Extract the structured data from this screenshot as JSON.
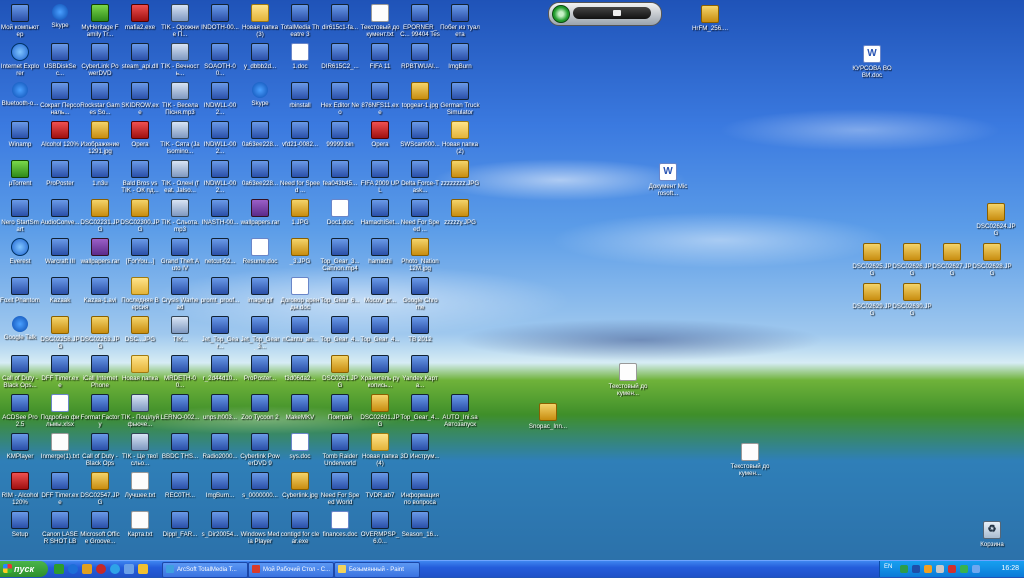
{
  "desktop": {
    "grid": [
      [
        "Мой компьютер",
        "Skype",
        "MyHeritage Family Tr...",
        "mafia2.exe",
        "TIK - Орожние П...",
        "INDOTH-00...",
        "Новая папка (3)",
        "TotalMedia Theatre 3",
        "dir615c1-fa...",
        "Текстовый документ.txt",
        "EPORNER_C... 99404 Test",
        "Побег из туалета"
      ],
      [
        "Internet Explorer",
        "USBDiskSec...",
        "CyberLink PowerDVD",
        "steam_api.dll",
        "TIK - Вечность...",
        "SOAOTH-00...",
        "y_dbbb2d...",
        "1.doc",
        "DIR615C2_...",
        "FIFA 11",
        "RPBTWUAI...",
        "ImgBurn"
      ],
      [
        "Bluetooth-о...",
        "Сократ Персональ...",
        "Rockstar Games So...",
        "SKIDROW.exe",
        "TIK - Весела Пісня.mp3",
        "INDWLL-002...",
        "Skype",
        "rbinstall",
        "Hex Editor Neo",
        "876NFS11.exe",
        "topgear-1.jpg",
        "German Truck Simulator"
      ],
      [
        "Winamp",
        "Alcohol 120%",
        "Изображение 1291.jpg",
        "Opera",
        "TIK - Сята (Jalsomino...",
        "INDWLL-002...",
        "0a63ee228...",
        "vfd21-0082...",
        "99999.bin",
        "Opera",
        "SWScan000...",
        "Новая папка (2)"
      ],
      [
        "µTorrent",
        "ProPoster",
        "1.n3u",
        "Bald Bros vs TIK - ОК пд...",
        "TIK - Олені (feat. Jalso...",
        "INDWLL-002...",
        "0a63ee228...",
        "Need for Speed ...",
        "fea043b45...",
        "FIFA 2009 UPL",
        "Delta Force-Task...",
        "zzzzzzzz.JPG"
      ],
      [
        "Nero StartSmart",
        "AudioConve...",
        "DSC02231.JPG",
        "DSC02300.JPG",
        "TIK - Сльота.mp3",
        "INASTH-00...",
        "wallpapers.rar",
        "1.JPG",
        "Doc1.doc",
        "HamachiSet...",
        "Need For Speed ...",
        "zzzzzy.JPG"
      ],
      [
        "Everest",
        "Warcraft III",
        "wallpapers.rar",
        "[ForYou...]",
        "Grand Theft Auto IV",
        "netcut-02...",
        "Resume.doc",
        "_3.JPG",
        "Top_Gear_3... Cannon.mp4",
        "hamachi",
        "Photo_Nation 12M.jpg",
        ""
      ],
      [
        "Foxit Phantom",
        "Kazaak",
        "Kazaa-1.avi",
        "Последняя Версия",
        "Crysis Warhead",
        "promt_proof...",
        "image.gif",
        "Договор аренды.doc",
        "Top_Gear_6...",
        "Mocov_pr...",
        "Google Chrome",
        ""
      ],
      [
        "Google Talk",
        "DSC02258.JPG",
        "DSC02263.JPG",
        "DSC...JPG",
        "TIK...",
        "Jet_Top_Gear...",
        "Jet_Top_Gear_3...",
        "nCantu_an...",
        "Top_Gear_4...",
        "Top_Gear_4...",
        "ТВ 2012",
        ""
      ],
      [
        "Call of Duty - Black Ops...",
        "DFF Timer.exe",
        "iCall Internet Phone",
        "Новая папка",
        "MRDETH-00...",
        "r_2d44d10...",
        "ProPoster...",
        "f3d06da2...",
        "DSC0261.JPG",
        "Хранитель рукопись...",
        "Yandex Карта...",
        ""
      ],
      [
        "ACDSee Pro 2.5",
        "Подробно фильмы.xlsx",
        "Format Factory",
        "TIK - Поцілуй фьюче...",
        "LERNO-002...",
        "unps.h003...",
        "Zoo Tycoon 2",
        "MakeMKV",
        "Поиграй",
        "DSC02601.JPG",
        "Top_Gear_4...",
        "AUTO_Ini.sa Автозапуск"
      ],
      [
        "KMPlayer",
        "Inmerge(1).txt",
        "Call of Duty - Black Ops",
        "TIK - Це твої сльо...",
        "BBDC THS...",
        "Radio2000...",
        "Cyberlink PowerDVD 9",
        "sys.doc",
        "Tomb Raider Underworld",
        "Новая папка (4)",
        "3D Инструм...",
        ""
      ],
      [
        "RIM - Alcohol 120%",
        "DFF Timer.exe",
        "DSC02547.JPG",
        "Лучшее.txt",
        "REC0TH...",
        "ImgBurn...",
        "s_0000000...",
        "Cyberlink.jpg",
        "Need For Speed World",
        "TVDR.ab7",
        "Информация по вопросам...",
        ""
      ],
      [
        "Setup",
        "Canon LASER SHOT LBP...",
        "Microsoft Office Groove...",
        "Карта.txt",
        "Dippl_FAR...",
        "s_Dir20054...",
        "Windows Media Player",
        "contigd for clear.exe",
        "finances.doc",
        "OVERMPSP_6.0...",
        "Season_16...",
        ""
      ]
    ],
    "right_icons": {
      "hrfm": "HrFM_256....",
      "kursova": "КУРСОВА ВОВИ.doc",
      "docword": "Документ Microsoft...",
      "dsc2624": "DSC02624.JPG",
      "dsc2625": "DSC02625.JPG",
      "dsc2626": "DSC02626.JPG",
      "dsc2627": "DSC02627.JPG",
      "dsc2628": "DSC02628.JPG",
      "dsc2629": "DSC02629.JPG",
      "dsc2630": "DSC02630.JPG",
      "textdoc1": "Текстовый докумен...",
      "snopac": "Snopac_Inn...",
      "textdoc2": "Текстовый докумен...",
      "recycle": "Корзина"
    }
  },
  "taskbar": {
    "start_label": "пуск",
    "tasks": [
      "ArcSoft TotalMedia T...",
      "Мой Рабочий Стол - С...",
      "Безымянный - Paint"
    ],
    "lang": "EN",
    "clock": "16:28"
  },
  "colors": {
    "taskbar": "#245ddb",
    "start": "#2d8f2d",
    "tray": "#0b7ad8"
  }
}
